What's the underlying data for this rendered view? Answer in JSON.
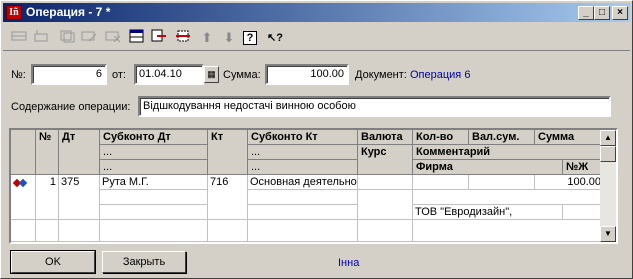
{
  "window": {
    "title": "Операция - 7 *",
    "app_icon_text": "Iñ",
    "minimize_glyph": "_",
    "maximize_glyph": "□",
    "close_glyph": "×"
  },
  "toolbar": {
    "icons": [
      "new-row-icon",
      "insert-row-icon",
      "copy-row-icon",
      "edit-row-icon",
      "delete-row-icon",
      "table-icon",
      "link-icon",
      "move-icon",
      "up-arrow-icon",
      "down-arrow-icon",
      "help-icon",
      "context-help-icon"
    ],
    "up_glyph": "⬆",
    "down_glyph": "⬇",
    "help_glyph": "?",
    "context_help_glyph": "↖?"
  },
  "form": {
    "number_label": "№:",
    "number_value": "6",
    "date_label": "от:",
    "date_value": "01.04.10",
    "calendar_glyph": "▦",
    "sum_label": "Сумма:",
    "sum_value": "100.00",
    "document_label": "Документ:",
    "document_link": "Операция 6",
    "content_label": "Содержание операции:",
    "content_value": "Відшкодування недостачі винною особою"
  },
  "table": {
    "headers": {
      "num": "№",
      "dt": "Дт",
      "subkonto_dt": "Субконто Дт",
      "kt": "Кт",
      "subkonto_kt": "Субконто Кт",
      "currency": "Валюта",
      "rate": "Курс",
      "qty": "Кол-во",
      "cur_sum": "Вал.сум.",
      "sum": "Сумма",
      "comment": "Комментарий",
      "firm": "Фирма",
      "journal_no": "№Ж",
      "dots": "..."
    },
    "rows": [
      {
        "icon": "posting-icon",
        "num": "1",
        "dt": "375",
        "subkonto_dt": "Рута М.Г.",
        "kt": "716",
        "subkonto_kt": "Основная деятельность",
        "sum": "100.00",
        "firm": "ТОВ \"Евродизайн\","
      }
    ]
  },
  "buttons": {
    "ok": "OK",
    "close": "Закрыть"
  },
  "status": {
    "user": "Інна"
  },
  "colors": {
    "title_start": "#0a246a",
    "title_end": "#a6caf0",
    "link": "#0000b0",
    "face": "#d4d0c8"
  }
}
